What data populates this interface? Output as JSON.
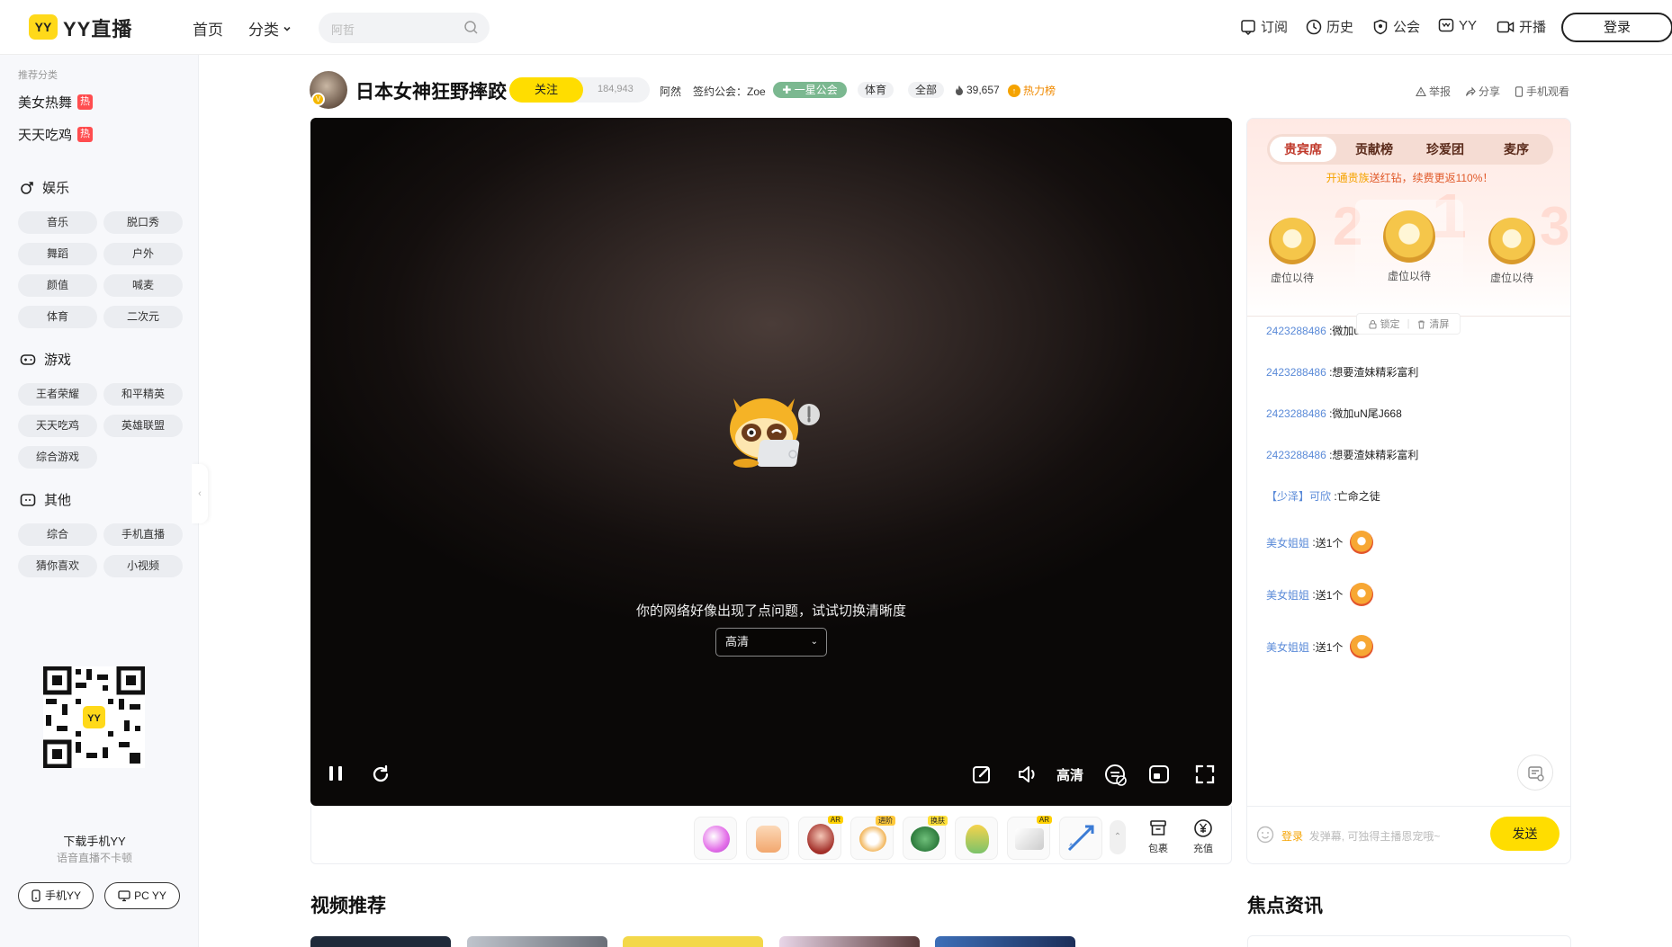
{
  "header": {
    "logo_badge": "YY",
    "logo_text": "YY直播",
    "nav": {
      "home": "首页",
      "category": "分类"
    },
    "search_placeholder": "阿哲",
    "right_nav": {
      "subscribe": "订阅",
      "history": "历史",
      "guild": "公会",
      "yy": "YY",
      "broadcast": "开播"
    },
    "login": "登录"
  },
  "sidebar": {
    "caption": "推荐分类",
    "recommended": [
      {
        "label": "美女热舞",
        "badge": "热"
      },
      {
        "label": "天天吃鸡",
        "badge": "热"
      }
    ],
    "sections": [
      {
        "title": "娱乐",
        "items": [
          "音乐",
          "脱口秀",
          "舞蹈",
          "户外",
          "颜值",
          "喊麦",
          "体育",
          "二次元"
        ]
      },
      {
        "title": "游戏",
        "items": [
          "王者荣耀",
          "和平精英",
          "天天吃鸡",
          "英雄联盟",
          "综合游戏"
        ]
      },
      {
        "title": "其他",
        "items": [
          "综合",
          "手机直播",
          "猜你喜欢",
          "小视频"
        ]
      }
    ],
    "download_title": "下载手机YY",
    "download_sub": "语音直播不卡顿",
    "mobile_btn": "手机YY",
    "pc_btn": "PC YY"
  },
  "room": {
    "title": "日本女神狂野摔跤",
    "follow": "关注",
    "follow_count": "184,943",
    "host": "阿然",
    "guild_label": "签约公会：Zoe",
    "guild_badge": "一星公会",
    "tags": [
      "体育",
      "全部"
    ],
    "heat": "39,657",
    "hot_rank": "热力榜",
    "actions": {
      "report": "举报",
      "share": "分享",
      "mobile": "手机观看"
    }
  },
  "player": {
    "error_message": "你的网络好像出现了点问题，试试切换清晰度",
    "clarity": "高清",
    "clarity_label": "高清"
  },
  "giftbar": {
    "ar": "AR",
    "advanced": "进阶",
    "upgrade": "换肤",
    "package": "包裹",
    "recharge": "充值"
  },
  "panel": {
    "tabs": [
      "贵宾席",
      "贡献榜",
      "珍爱团",
      "麦序"
    ],
    "vip_tip_prefix": "开通贵族",
    "vip_tip": "送红钻，续费更返110%！",
    "seats": [
      "虚位以待",
      "虚位以待",
      "虚位以待"
    ],
    "rank_nums": [
      "2",
      "1",
      "3"
    ],
    "lock": "锁定",
    "clear": "清屏",
    "chat": [
      {
        "user": "2423288486",
        "text": "微加u"
      },
      {
        "user": "2423288486",
        "text": "想要渣妹精彩富利"
      },
      {
        "user": "2423288486",
        "text": "微加uN尾J668"
      },
      {
        "user": "2423288486",
        "text": "想要渣妹精彩富利"
      },
      {
        "user": "【少泽】可欣",
        "text": "亡命之徒"
      },
      {
        "user": "美女姐姐",
        "text": "送1个"
      },
      {
        "user": "美女姐姐",
        "text": "送1个"
      },
      {
        "user": "美女姐姐",
        "text": "送1个"
      }
    ],
    "input_login": "登录",
    "input_placeholder": "发弹幕, 可独得主播恩宠哦~",
    "send": "发送"
  },
  "bottom": {
    "video_rec": "视频推荐",
    "focus_news": "焦点资讯"
  },
  "colors": {
    "brand": "#ffdd00",
    "accent_red": "#ff4d4f",
    "link": "#5a8ad8"
  }
}
